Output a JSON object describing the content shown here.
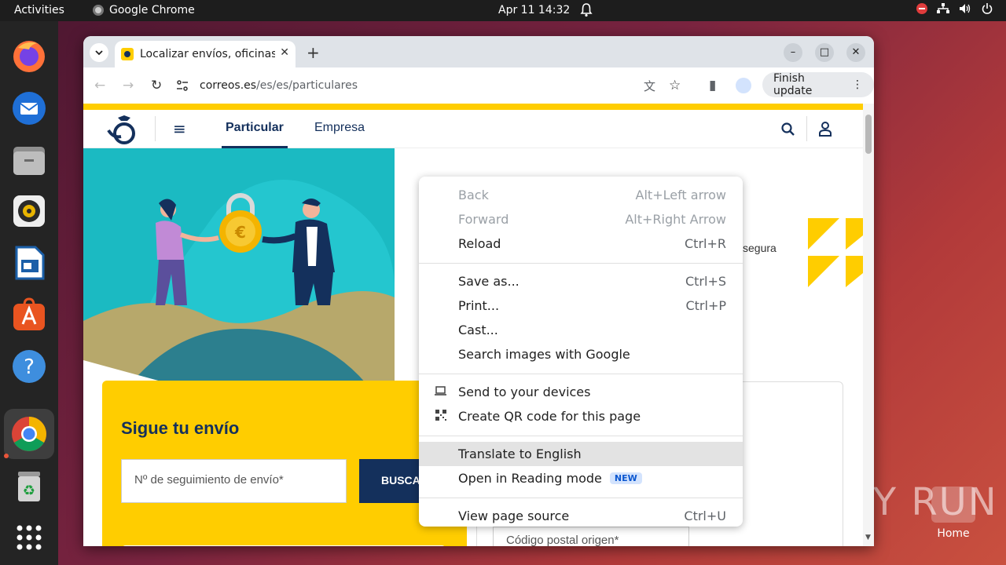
{
  "topbar": {
    "activities": "Activities",
    "app_name": "Google Chrome",
    "clock": "Apr 11  14:32"
  },
  "dock": {
    "items": [
      "firefox",
      "thunderbird",
      "files",
      "rhythmbox",
      "libreoffice-writer",
      "app-center",
      "help",
      "google-chrome",
      "trash",
      "show-apps"
    ]
  },
  "browser": {
    "tab_title": "Localizar envíos, oficinas",
    "url_host": "correos.es",
    "url_path": "/es/es/particulares",
    "finish_update": "Finish update"
  },
  "site": {
    "nav": {
      "particular": "Particular",
      "empresa": "Empresa"
    },
    "track_title": "Sigue tu envío",
    "track_placeholder": "Nº de seguimiento de envío*",
    "track_button": "BUSCAR",
    "partial_text": "segura",
    "cp_placeholder": "Código postal origen*"
  },
  "context_menu": {
    "items": [
      {
        "label": "Back",
        "shortcut": "Alt+Left arrow"
      },
      {
        "label": "Forward",
        "shortcut": "Alt+Right Arrow"
      },
      {
        "label": "Reload",
        "shortcut": "Ctrl+R"
      },
      {
        "label": "Save as...",
        "shortcut": "Ctrl+S"
      },
      {
        "label": "Print...",
        "shortcut": "Ctrl+P"
      },
      {
        "label": "Cast..."
      },
      {
        "label": "Search images with Google"
      },
      {
        "label": "Send to your devices"
      },
      {
        "label": "Create QR code for this page"
      },
      {
        "label": "Translate to English"
      },
      {
        "label": "Open in Reading mode",
        "badge": "NEW"
      },
      {
        "label": "View page source",
        "shortcut": "Ctrl+U"
      }
    ]
  },
  "desktop": {
    "home_label": "Home",
    "watermark": "ANY RUN"
  },
  "colors": {
    "correos_yellow": "#ffcd00",
    "correos_blue": "#14305c",
    "hero_teal": "#1bbac2"
  }
}
